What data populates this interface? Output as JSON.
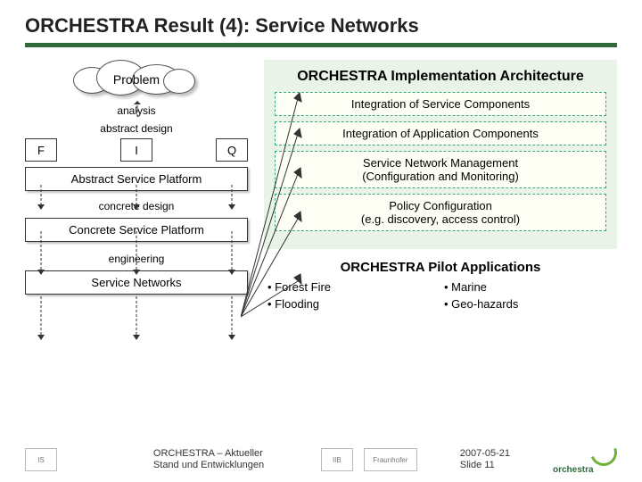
{
  "title": "ORCHESTRA Result (4): Service Networks",
  "left": {
    "problem": "Problem",
    "analysis": "analysis",
    "abstract_design": "abstract design",
    "F": "F",
    "I": "I",
    "Q": "Q",
    "abstract_platform": "Abstract Service Platform",
    "concrete_design": "concrete design",
    "concrete_platform": "Concrete Service Platform",
    "engineering": "engineering",
    "service_networks": "Service Networks"
  },
  "arch": {
    "title": "ORCHESTRA Implementation Architecture",
    "b1": "Integration of Service Components",
    "b2": "Integration of Application Components",
    "b3": "Service Network Management\n(Configuration and Monitoring)",
    "b4": "Policy Configuration\n(e.g. discovery, access control)"
  },
  "pilot": {
    "title": "ORCHESTRA Pilot Applications",
    "items": [
      "Forest Fire",
      "Marine",
      "Flooding",
      "Geo-hazards"
    ]
  },
  "footer": {
    "caption": "ORCHESTRA – Aktueller Stand und Entwicklungen",
    "date": "2007-05-21",
    "slide": "Slide 11",
    "brand": "orchestra"
  }
}
